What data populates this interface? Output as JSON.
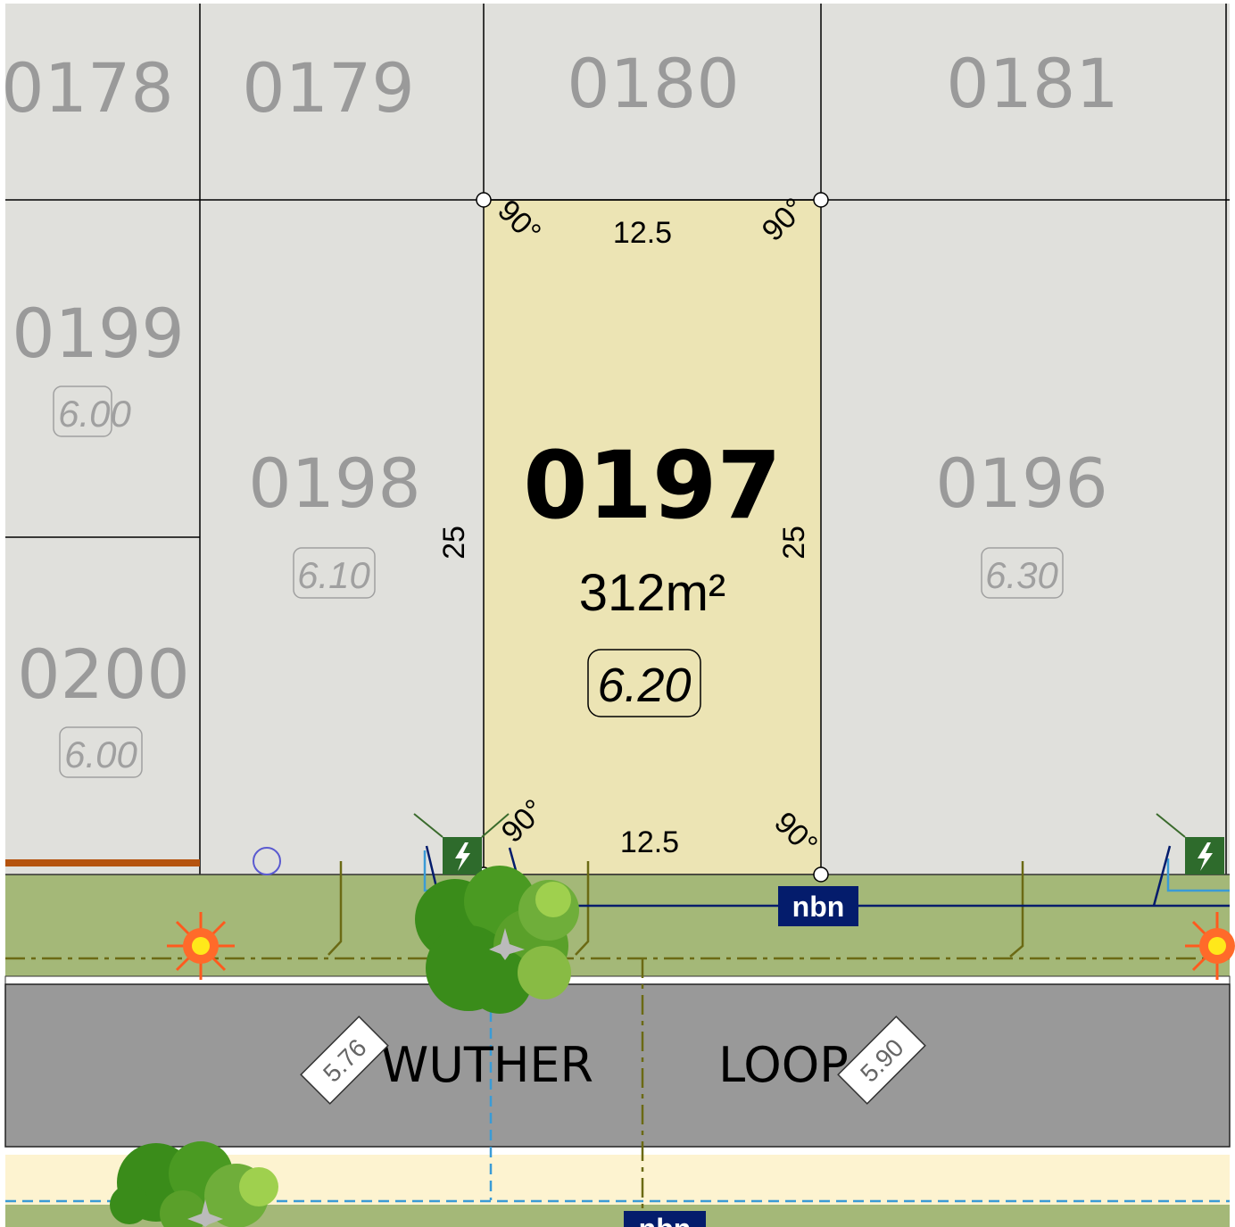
{
  "lots": {
    "l0178": "0178",
    "l0179": "0179",
    "l0180": "0180",
    "l0181": "0181",
    "l0199": "0199",
    "l0199_level": "6.00",
    "l0198": "0198",
    "l0198_level": "6.10",
    "l0200": "0200",
    "l0200_level": "6.00",
    "l0196": "0196",
    "l0196_level": "6.30"
  },
  "selected_lot": {
    "number": "0197",
    "area": "312m²",
    "level": "6.20",
    "frontage": "12.5",
    "rear": "12.5",
    "depth_left": "25",
    "depth_right": "25",
    "angle": "90°"
  },
  "street": {
    "name_part1": "WUTHER",
    "name_part2": "LOOP",
    "road_level_left": "5.76",
    "road_level_right": "5.90"
  },
  "services": {
    "nbn_label": "nbn"
  },
  "colors": {
    "selected_lot": "#ece4b4",
    "other_lot": "#e0e0dc",
    "verge": "#a4b878",
    "road": "#999999",
    "footpath": "#fdf3d0",
    "nbn": "#041c6c"
  }
}
